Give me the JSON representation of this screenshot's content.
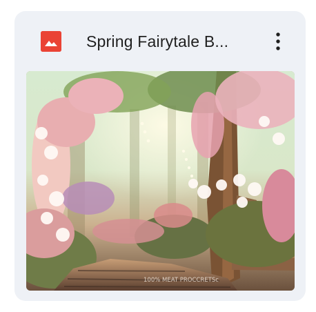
{
  "card": {
    "title": "Spring Fairytale B...",
    "file_type_icon": "image-file-icon",
    "menu_icon": "more-vertical-icon",
    "thumbnail_icon": "image-thumbnail",
    "thumbnail_watermark": "100% MEAT PROCCRETSc",
    "colors": {
      "card_background": "#eef1f6",
      "file_icon": "#ea4335",
      "title_text": "#1f1f1f"
    }
  }
}
